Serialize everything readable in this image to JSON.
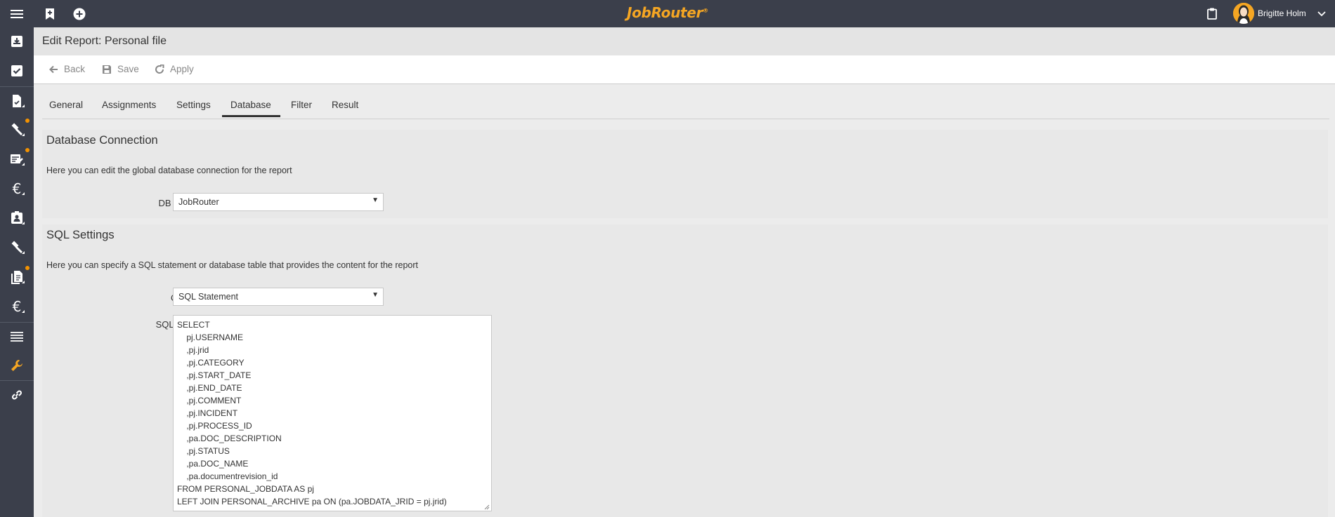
{
  "app": {
    "logo": "JobRouter",
    "logo_mark": "®",
    "user_name": "Brigitte Holm"
  },
  "icons": {
    "menu": "menu-icon",
    "bookmark": "bookmark-add-icon",
    "add": "plus-circle-icon",
    "clipboard": "clipboard-icon",
    "chevron": "chevron-down-icon"
  },
  "colors": {
    "topbar": "#3b3f4b",
    "accent": "#f5a623",
    "badge": "#f39200"
  },
  "page": {
    "title": "Edit Report: Personal file"
  },
  "toolbar": {
    "back_label": "Back",
    "save_label": "Save",
    "apply_label": "Apply"
  },
  "tabs": [
    {
      "label": "General"
    },
    {
      "label": "Assignments"
    },
    {
      "label": "Settings"
    },
    {
      "label": "Database",
      "active": true
    },
    {
      "label": "Filter"
    },
    {
      "label": "Result"
    }
  ],
  "db_section": {
    "title": "Database Connection",
    "description": "Here you can edit the global database connection for the report",
    "connection_label": "DB Connection",
    "required_mark": "*",
    "connection_value": "JobRouter"
  },
  "sql_section": {
    "title": "SQL Settings",
    "description": "Here you can specify a SQL statement or database table that provides the content for the report",
    "query_type_label": "Query Type",
    "query_type_value": "SQL Statement",
    "statement_label": "SQL Statement",
    "statement_value": "SELECT\n\tpj.USERNAME\n\t,pj.jrid\n\t,pj.CATEGORY\n\t,pj.START_DATE\n\t,pj.END_DATE\n\t,pj.COMMENT\n\t,pj.INCIDENT\n\t,pj.PROCESS_ID\n\t,pa.DOC_DESCRIPTION\n\t,pj.STATUS\n\t,pa.DOC_NAME\n\t,pa.documentrevision_id\nFROM PERSONAL_JOBDATA AS pj\nLEFT JOIN PERSONAL_ARCHIVE pa ON (pa.JOBDATA_JRID = pj.jrid)"
  }
}
